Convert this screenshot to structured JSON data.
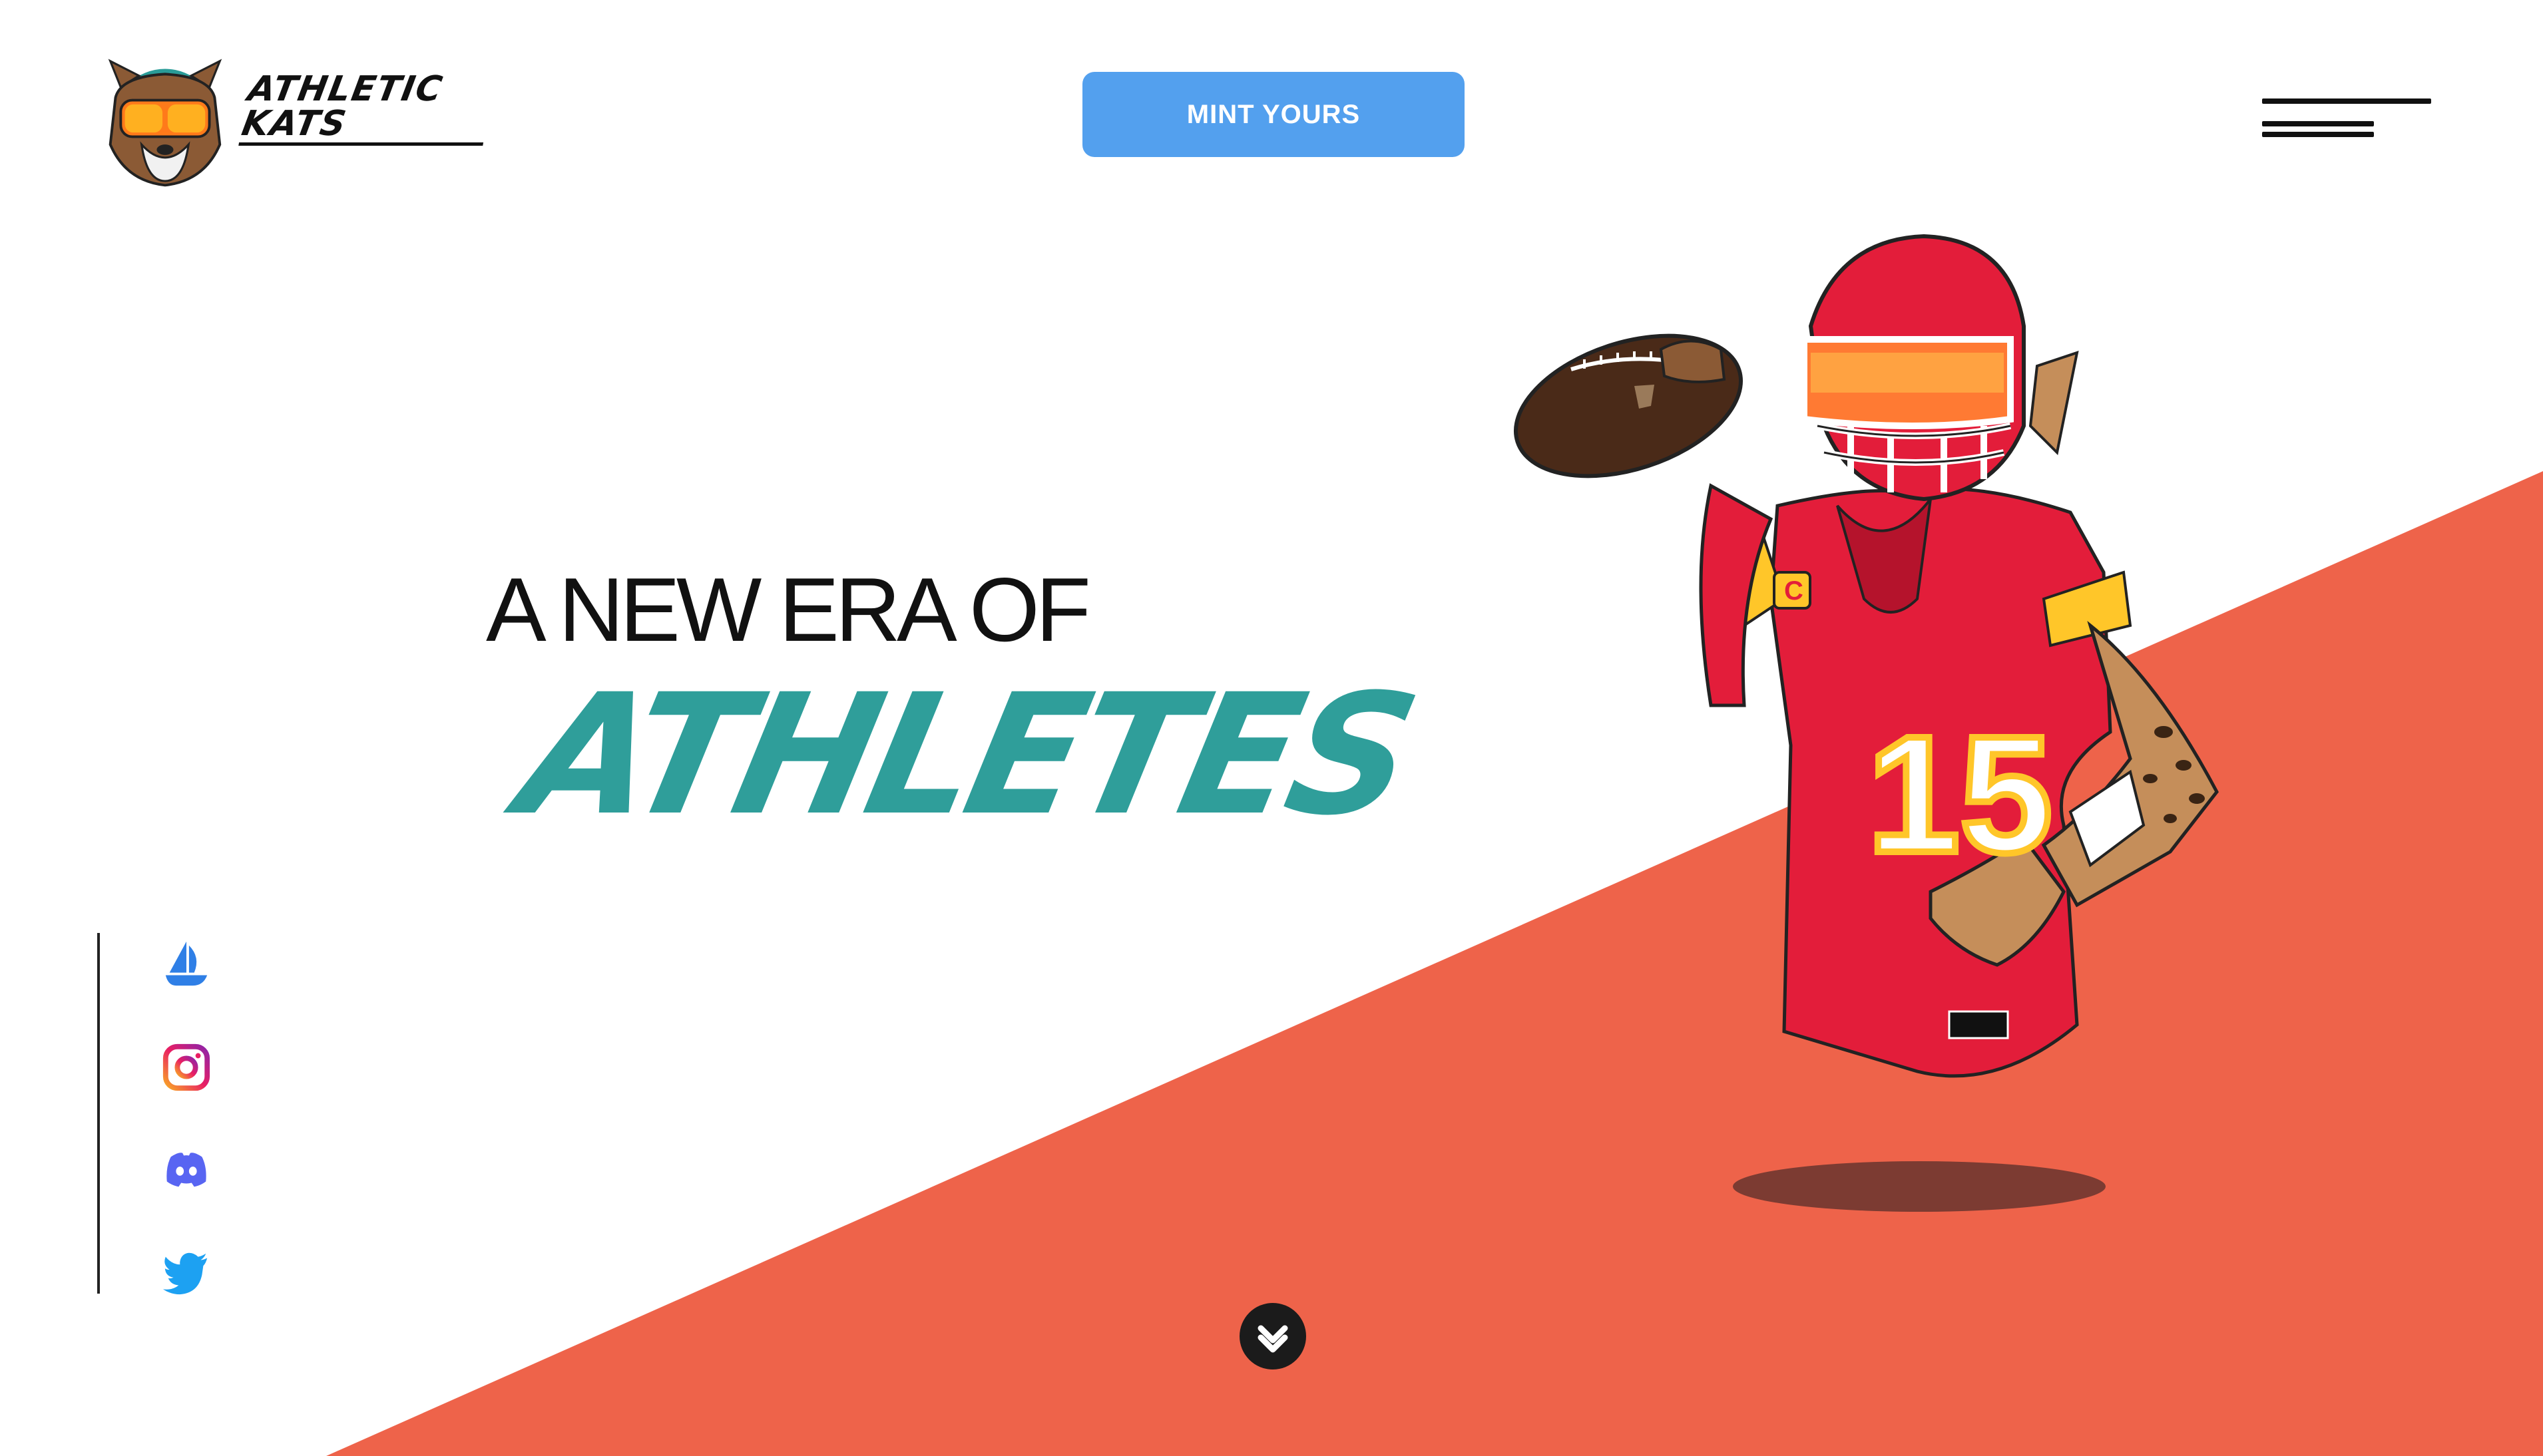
{
  "brand": {
    "name": "ATHLETIC KATS",
    "logo_icon": "tiger-goggles-logo-icon"
  },
  "header": {
    "mint_label": "MINT YOURS",
    "menu_icon": "hamburger-menu-icon"
  },
  "hero": {
    "line1": "A NEW ERA OF",
    "line2": "ATHLETES"
  },
  "socials": [
    {
      "name": "OpenSea",
      "icon": "opensea-icon"
    },
    {
      "name": "Instagram",
      "icon": "instagram-icon"
    },
    {
      "name": "Discord",
      "icon": "discord-icon"
    },
    {
      "name": "Twitter",
      "icon": "twitter-icon"
    }
  ],
  "illustration": {
    "jersey_number": "15",
    "captain_badge": "C"
  },
  "scroll": {
    "icon": "chevron-down-icon"
  },
  "colors": {
    "accent": "#53a0ee",
    "teal": "#2f9e9a",
    "wedge": "#ee634a",
    "jersey": "#e31d3a",
    "text": "#111111"
  }
}
